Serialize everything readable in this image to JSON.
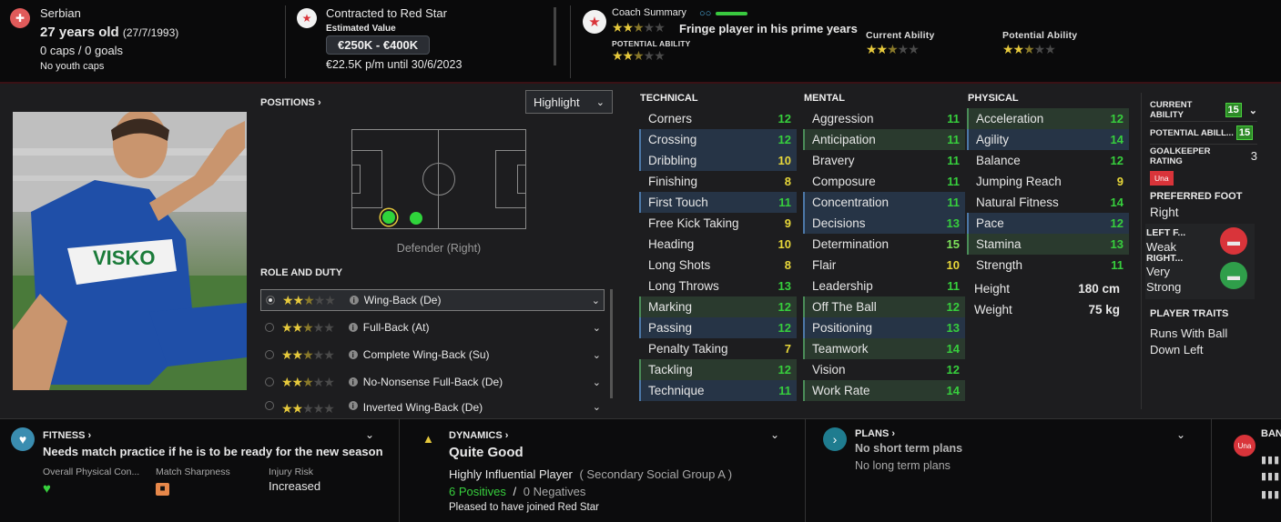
{
  "header": {
    "nationality": "Serbian",
    "age": "27 years old",
    "dob": "(27/7/1993)",
    "caps": "0 caps / 0 goals",
    "youth_caps": "No youth caps",
    "contract_title": "Contracted to Red Star",
    "estimated_value_label": "Estimated Value",
    "estimated_value": "€250K - €400K",
    "wage": "€22.5K p/m until 30/6/2023",
    "coach_summary_label": "Coach Summary",
    "coach_summary": "Fringe player in his prime years",
    "potential_ability_label": "POTENTIAL ABILITY",
    "current_ability_label": "Current Ability",
    "potential_ability_label2": "Potential Ability",
    "current_stars": 2.5,
    "potential_stars": 2.5
  },
  "positions": {
    "title": "POSITIONS",
    "highlight_select": "Highlight",
    "position_label": "Defender (Right)"
  },
  "role_and_duty": {
    "title": "ROLE AND DUTY",
    "roles": [
      {
        "label": "Wing-Back (De)",
        "stars": 2.5,
        "selected": true
      },
      {
        "label": "Full-Back (At)",
        "stars": 2.5,
        "selected": false
      },
      {
        "label": "Complete Wing-Back (Su)",
        "stars": 2.5,
        "selected": false
      },
      {
        "label": "No-Nonsense Full-Back (De)",
        "stars": 2.5,
        "selected": false
      },
      {
        "label": "Inverted Wing-Back (De)",
        "stars": 2,
        "selected": false
      }
    ]
  },
  "technical": {
    "title": "TECHNICAL",
    "rows": [
      {
        "name": "Corners",
        "value": "12"
      },
      {
        "name": "Crossing",
        "value": "12"
      },
      {
        "name": "Dribbling",
        "value": "10"
      },
      {
        "name": "Finishing",
        "value": "8"
      },
      {
        "name": "First Touch",
        "value": "11"
      },
      {
        "name": "Free Kick Taking",
        "value": "9"
      },
      {
        "name": "Heading",
        "value": "10"
      },
      {
        "name": "Long Shots",
        "value": "8"
      },
      {
        "name": "Long Throws",
        "value": "13"
      },
      {
        "name": "Marking",
        "value": "12"
      },
      {
        "name": "Passing",
        "value": "12"
      },
      {
        "name": "Penalty Taking",
        "value": "7"
      },
      {
        "name": "Tackling",
        "value": "12"
      },
      {
        "name": "Technique",
        "value": "11"
      }
    ]
  },
  "mental": {
    "title": "MENTAL",
    "rows": [
      {
        "name": "Aggression",
        "value": "11"
      },
      {
        "name": "Anticipation",
        "value": "11"
      },
      {
        "name": "Bravery",
        "value": "11"
      },
      {
        "name": "Composure",
        "value": "11"
      },
      {
        "name": "Concentration",
        "value": "11"
      },
      {
        "name": "Decisions",
        "value": "13"
      },
      {
        "name": "Determination",
        "value": "15"
      },
      {
        "name": "Flair",
        "value": "10"
      },
      {
        "name": "Leadership",
        "value": "11"
      },
      {
        "name": "Off The Ball",
        "value": "12"
      },
      {
        "name": "Positioning",
        "value": "13"
      },
      {
        "name": "Teamwork",
        "value": "14"
      },
      {
        "name": "Vision",
        "value": "12"
      },
      {
        "name": "Work Rate",
        "value": "14"
      }
    ]
  },
  "physical": {
    "title": "PHYSICAL",
    "rows": [
      {
        "name": "Acceleration",
        "value": "12"
      },
      {
        "name": "Agility",
        "value": "14"
      },
      {
        "name": "Balance",
        "value": "12"
      },
      {
        "name": "Jumping Reach",
        "value": "9"
      },
      {
        "name": "Natural Fitness",
        "value": "14"
      },
      {
        "name": "Pace",
        "value": "12"
      },
      {
        "name": "Stamina",
        "value": "13"
      },
      {
        "name": "Strength",
        "value": "11"
      }
    ],
    "height_label": "Height",
    "height": "180 cm",
    "weight_label": "Weight",
    "weight": "75 kg"
  },
  "side": {
    "current_ability_label": "CURRENT ABILITY",
    "current_ability": "15",
    "potential_ability_label": "POTENTIAL ABILL...",
    "potential_ability": "15",
    "gk_rating_label": "GOALKEEPER RATING",
    "gk_rating": "3",
    "una_label": "Una",
    "preferred_foot_label": "PREFERRED FOOT",
    "preferred_foot": "Right",
    "left_foot_label": "LEFT F...",
    "left_foot_value": "Weak",
    "right_foot_label": "RIGHT...",
    "right_foot_value_1": "Very",
    "right_foot_value_2": "Strong",
    "traits_label": "PLAYER TRAITS",
    "trait_1": "Runs With Ball",
    "trait_2": "Down Left"
  },
  "fitness": {
    "title": "FITNESS",
    "summary": "Needs match practice if he is to be ready for the new season",
    "col1_label": "Overall Physical Con...",
    "col2_label": "Match Sharpness",
    "col3_label": "Injury Risk",
    "injury_risk": "Increased"
  },
  "dynamics": {
    "title": "DYNAMICS",
    "summary": "Quite Good",
    "influence": "Highly Influential Player",
    "social_group": "( Secondary Social Group A )",
    "positives": "6 Positives",
    "separator": "/",
    "negatives": "0 Negatives",
    "note": "Pleased to have joined Red Star"
  },
  "plans": {
    "title": "PLANS",
    "short_term": "No short term plans",
    "long_term": "No long term plans"
  },
  "bans": {
    "title": "BAN",
    "una_label": "Una"
  },
  "colors": {
    "accent_red": "#d9343a",
    "attr_green": "#37cf3d",
    "attr_yellow": "#e8d83a",
    "highlight_blue": "#263446",
    "highlight_green": "#2a3a2e"
  }
}
